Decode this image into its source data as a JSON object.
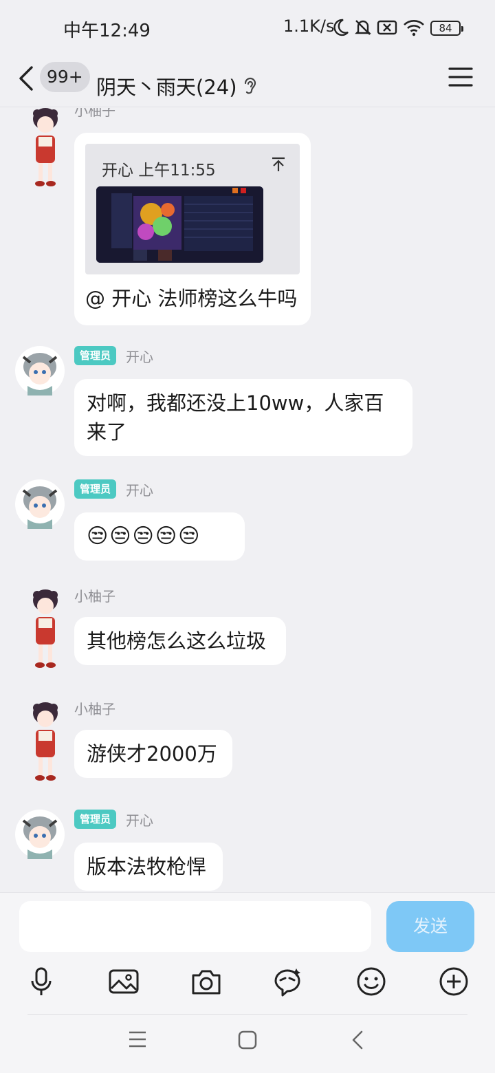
{
  "status_bar": {
    "time": "中午12:49",
    "net_speed": "1.1K/s",
    "battery": "84"
  },
  "header": {
    "unread_count": "99+",
    "title": "阴天丶雨天(24)"
  },
  "messages": [
    {
      "sender": "小柚子",
      "reply": {
        "author_time": "开心 上午11:55"
      },
      "text": "@ 开心 法师榜这么牛吗"
    },
    {
      "sender": "开心",
      "role": "管理员",
      "text": "对啊，我都还没上10ww，人家百来了"
    },
    {
      "sender": "开心",
      "role": "管理员",
      "text": "😒😒😒😒😒"
    },
    {
      "sender": "小柚子",
      "text": "其他榜怎么这么垃圾"
    },
    {
      "sender": "小柚子",
      "text": "游侠才2000万"
    },
    {
      "sender": "开心",
      "role": "管理员",
      "text": "版本法牧枪悍"
    }
  ],
  "input": {
    "send_label": "发送"
  },
  "icons": {
    "back": "back-arrow-icon",
    "menu": "hamburger-menu-icon",
    "voice": "microphone-icon",
    "image": "image-icon",
    "camera": "camera-icon",
    "sticker": "sticker-icon",
    "emoji": "smiley-icon",
    "more": "plus-circle-icon"
  },
  "colors": {
    "background": "#f0f0f3",
    "bubble": "#ffffff",
    "admin_badge": "#4cc9c2",
    "send_button": "#7ec8f6"
  }
}
